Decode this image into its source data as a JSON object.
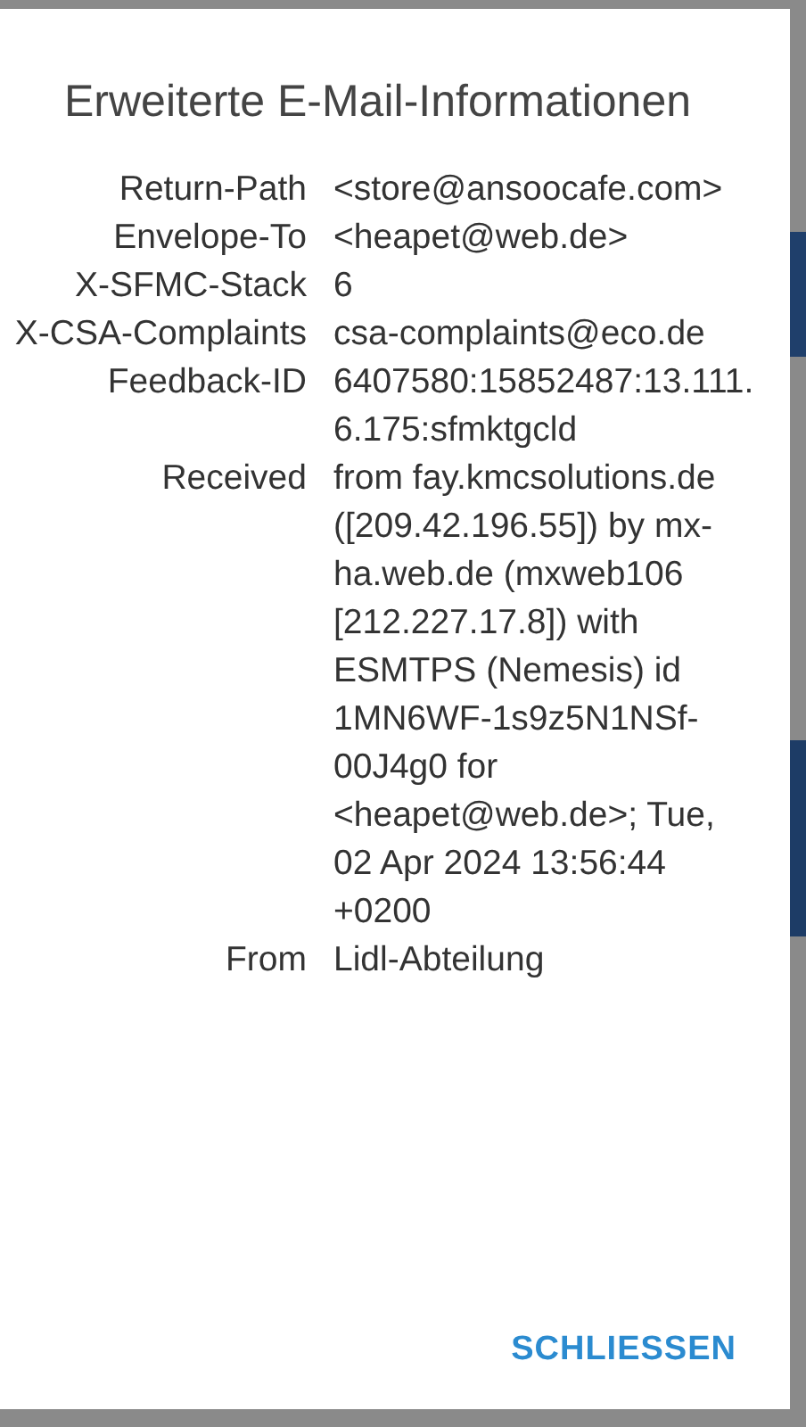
{
  "dialog": {
    "title": "Erweiterte E-Mail-Informationen",
    "headers": [
      {
        "name": "Return-Path",
        "value": "<store@ansoocafe.com>"
      },
      {
        "name": "Envelope-To",
        "value": "<heapet@web.de>"
      },
      {
        "name": "X-SFMC-Stack",
        "value": "6"
      },
      {
        "name": "X-CSA-Complaints",
        "value": "csa-complaints@eco.de"
      },
      {
        "name": "Feedback-ID",
        "value": "6407580:15852487:13.111.6.175:sfmktgcld"
      },
      {
        "name": "Received",
        "value": "from fay.kmcsolutions.de ([209.42.196.55]) by mx-ha.web.de (mxweb106 [212.227.17.8]) with ESMTPS (Nemesis) id 1MN6WF-1s9z5N1NSf-00J4g0 for <heapet@web.de>; Tue, 02 Apr 2024 13:56:44 +0200"
      },
      {
        "name": "From",
        "value": "Lidl-Abteilung"
      }
    ],
    "button": "SCHLIESSEN"
  }
}
